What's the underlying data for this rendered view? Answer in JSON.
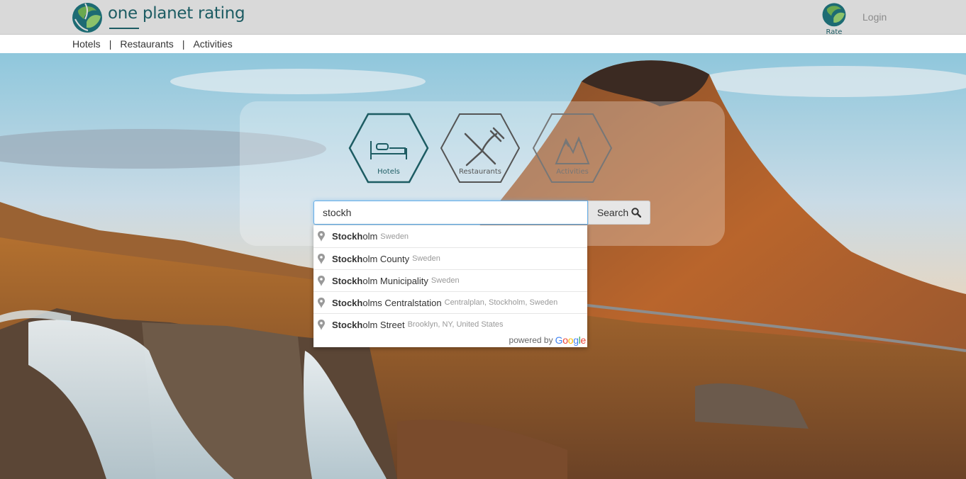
{
  "brand": {
    "name": "one planet rating",
    "logo_icon": "planet-leaf-logo-icon"
  },
  "header": {
    "rate_label": "Rate",
    "login_label": "Login"
  },
  "nav": {
    "items": [
      {
        "label": "Hotels"
      },
      {
        "label": "Restaurants"
      },
      {
        "label": "Activities"
      }
    ],
    "separator": "|"
  },
  "categories": [
    {
      "label": "Hotels",
      "icon": "bed-icon",
      "selected": true
    },
    {
      "label": "Restaurants",
      "icon": "fork-knife-icon",
      "selected": false
    },
    {
      "label": "Activities",
      "icon": "mountains-icon",
      "selected": false
    }
  ],
  "search": {
    "value": "stockh",
    "button_label": "Search",
    "button_icon": "search-icon"
  },
  "suggestions": [
    {
      "match": "Stockh",
      "rest": "olm",
      "secondary": "Sweden"
    },
    {
      "match": "Stockh",
      "rest": "olm County",
      "secondary": "Sweden"
    },
    {
      "match": "Stockh",
      "rest": "olm Municipality",
      "secondary": "Sweden"
    },
    {
      "match": "Stockh",
      "rest": "olms Centralstation",
      "secondary": "Centralplan, Stockholm, Sweden"
    },
    {
      "match": "Stockh",
      "rest": "olm Street",
      "secondary": "Brooklyn, NY, United States"
    }
  ],
  "attribution": {
    "powered_by": "powered by",
    "provider": "Google"
  },
  "colors": {
    "brand": "#1d5c63",
    "header_bg": "#d9d9d9",
    "focus_border": "#66afe9"
  }
}
